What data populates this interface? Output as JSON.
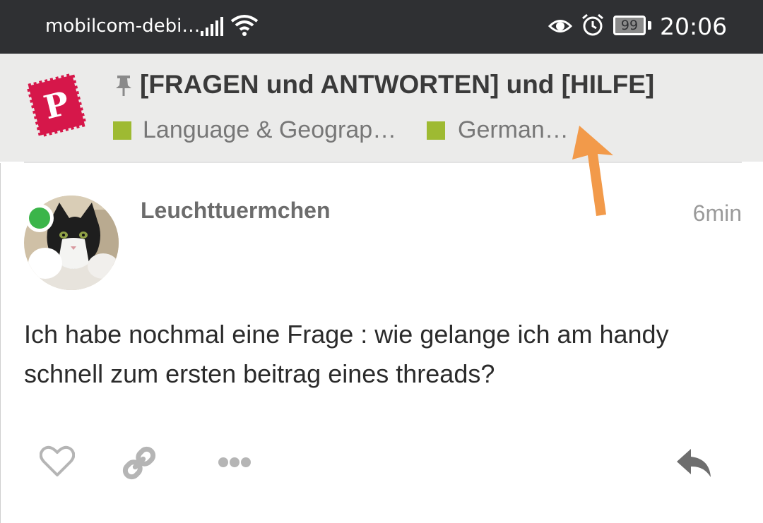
{
  "status_bar": {
    "carrier": "mobilcom-debi…",
    "battery": "99",
    "time": "20:06",
    "icons": [
      "signal-icon",
      "wifi-icon",
      "eye-icon",
      "alarm-icon",
      "battery-icon"
    ]
  },
  "topic": {
    "title": "[FRAGEN und ANTWORTEN] und [HILFE]",
    "categories": [
      {
        "label": "Language & Geograp…",
        "color": "#9eba32"
      },
      {
        "label": "German…",
        "color": "#9eba32"
      }
    ]
  },
  "post": {
    "username": "Leuchttuermchen",
    "age": "6min",
    "body": "Ich habe nochmal eine Frage : wie gelange ich am handy schnell zum ersten beitrag eines threads?",
    "online_status_color": "#3bb54a"
  },
  "actions": [
    "like-icon",
    "link-icon",
    "more-icon",
    "reply-icon"
  ],
  "colors": {
    "statusbar": "#2f3033",
    "header_bg": "#ebebea",
    "logo_red": "#d6174a",
    "annotation_arrow": "#f29a4a"
  }
}
